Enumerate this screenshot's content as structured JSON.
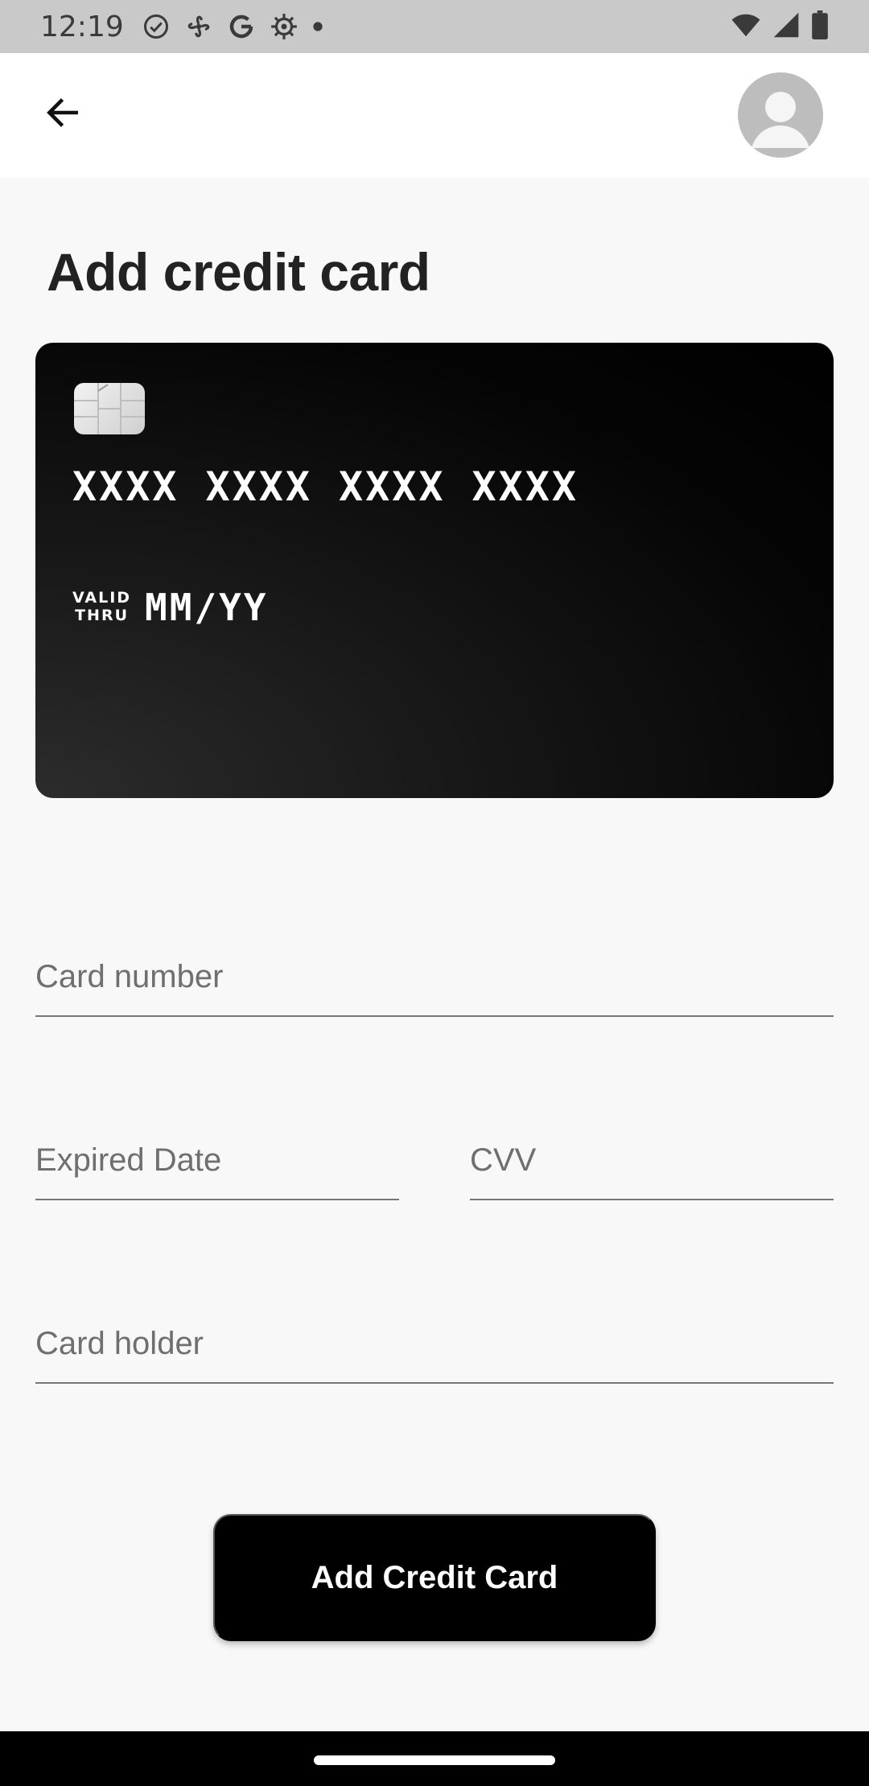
{
  "status_bar": {
    "time": "12:19",
    "icons": [
      "check-circle-icon",
      "fan-icon",
      "google-icon",
      "settings-gear-icon",
      "dot-icon"
    ],
    "right_icons": [
      "wifi-icon",
      "signal-icon",
      "battery-icon"
    ]
  },
  "app_bar": {
    "back_icon": "arrow-left-icon",
    "avatar_icon": "person-icon"
  },
  "page": {
    "title": "Add credit card"
  },
  "card_preview": {
    "number_placeholder": "XXXX XXXX XXXX XXXX",
    "valid_thru_line1": "VALID",
    "valid_thru_line2": "THRU",
    "expiry_placeholder": "MM/YY"
  },
  "form": {
    "card_number_label": "Card number",
    "expired_date_label": "Expired Date",
    "cvv_label": "CVV",
    "card_holder_label": "Card holder"
  },
  "actions": {
    "submit_label": "Add Credit Card"
  },
  "colors": {
    "background": "#f8f8f8",
    "card": "#000000",
    "button": "#000000",
    "status_bar": "#c9c9c9"
  }
}
